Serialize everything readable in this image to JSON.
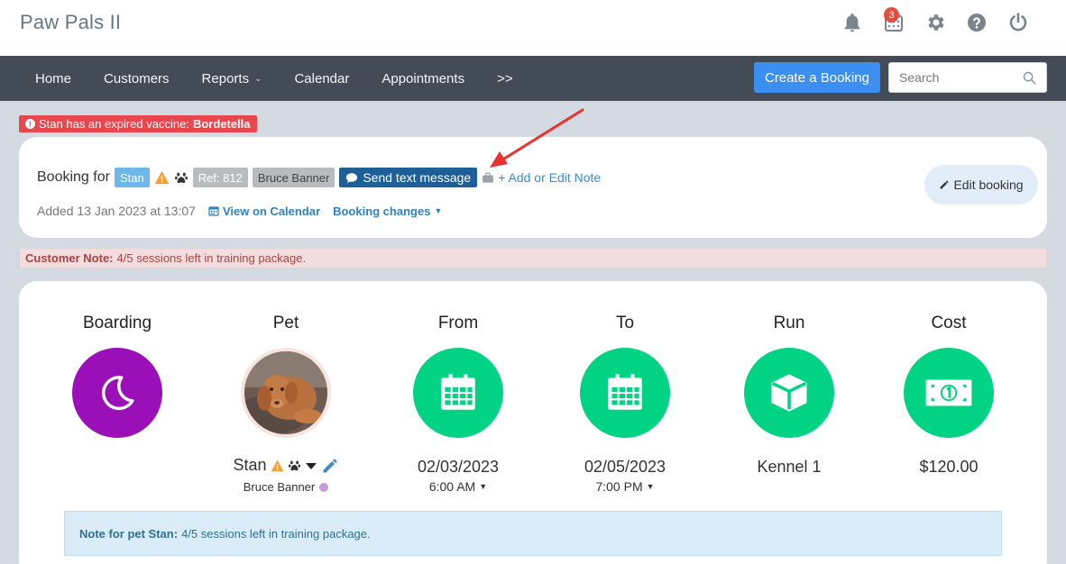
{
  "app": {
    "title": "Paw Pals II"
  },
  "header": {
    "icons": [
      "bell-icon",
      "calendar-grid-icon",
      "gear-icon",
      "help-icon",
      "power-icon"
    ],
    "calendar_badge": "3"
  },
  "nav": {
    "items": [
      {
        "label": "Home"
      },
      {
        "label": "Customers"
      },
      {
        "label": "Reports"
      },
      {
        "label": "Calendar"
      },
      {
        "label": "Appointments"
      },
      {
        "label": ">>"
      }
    ],
    "create_booking": "Create a Booking",
    "search_placeholder": "Search"
  },
  "alert": {
    "prefix": "Stan has an expired vaccine:",
    "vaccine": "Bordetella"
  },
  "booking": {
    "booking_for": "Booking for",
    "pet": "Stan",
    "ref": "Ref: 812",
    "owner": "Bruce Banner",
    "send_sms": "Send text message",
    "add_note": "+ Add or Edit Note",
    "added": "Added 13 Jan 2023 at 13:07",
    "view_calendar": "View on Calendar",
    "booking_changes": "Booking changes",
    "edit_booking": "Edit booking"
  },
  "customer_note": {
    "label": "Customer Note:",
    "text": "4/5 sessions left in training package."
  },
  "details": {
    "service": {
      "heading": "Boarding"
    },
    "pet": {
      "heading": "Pet",
      "name": "Stan",
      "owner": "Bruce Banner"
    },
    "from": {
      "heading": "From",
      "date": "02/03/2023",
      "time": "6:00 AM"
    },
    "to": {
      "heading": "To",
      "date": "02/05/2023",
      "time": "7:00 PM"
    },
    "run": {
      "heading": "Run",
      "value": "Kennel 1"
    },
    "cost": {
      "heading": "Cost",
      "value": "$120.00"
    }
  },
  "pet_note": {
    "label": "Note for pet Stan:",
    "text": "4/5 sessions left in training package."
  },
  "colors": {
    "nav_bg": "#434c56",
    "create_button": "#3c8ff0",
    "alert": "#e9474e",
    "boarding_circle": "#9b0fb9",
    "detail_circle": "#00d383",
    "sms_button": "#1f5f97"
  }
}
